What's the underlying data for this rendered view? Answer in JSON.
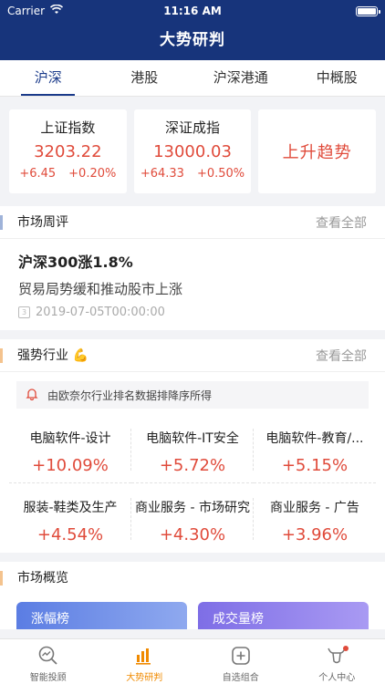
{
  "status_bar": {
    "carrier": "Carrier",
    "time": "11:16 AM"
  },
  "nav": {
    "title": "大势研判"
  },
  "tabs": [
    {
      "label": "沪深",
      "active": true
    },
    {
      "label": "港股",
      "active": false
    },
    {
      "label": "沪深港通",
      "active": false
    },
    {
      "label": "中概股",
      "active": false
    }
  ],
  "indices": [
    {
      "name": "上证指数",
      "value": "3203.22",
      "change": "+6.45",
      "pct": "+0.20%"
    },
    {
      "name": "深证成指",
      "value": "13000.03",
      "change": "+64.33",
      "pct": "+0.50%"
    }
  ],
  "trend": {
    "label": "上升趋势"
  },
  "market_review": {
    "title": "市场周评",
    "more": "查看全部",
    "headline": "沪深300涨1.8%",
    "subtitle": "贸易局势缓和推动股市上涨",
    "date": "2019-07-05T00:00:00",
    "calendar_day": "3"
  },
  "strong_industries": {
    "title": "强势行业",
    "emoji": "💪",
    "more": "查看全部",
    "notice": "由欧奈尔行业排名数据排降序所得",
    "items": [
      {
        "name": "电脑软件-设计",
        "pct": "+10.09%"
      },
      {
        "name": "电脑软件-IT安全",
        "pct": "+5.72%"
      },
      {
        "name": "电脑软件-教育/...",
        "pct": "+5.15%"
      },
      {
        "name": "服装-鞋类及生产",
        "pct": "+4.54%"
      },
      {
        "name": "商业服务 - 市场研究",
        "pct": "+4.30%"
      },
      {
        "name": "商业服务 - 广告",
        "pct": "+3.96%"
      }
    ]
  },
  "market_overview": {
    "title": "市场概览",
    "cards": [
      {
        "label": "涨幅榜"
      },
      {
        "label": "成交量榜"
      }
    ]
  },
  "tabbar": [
    {
      "label": "智能投顾",
      "icon": "magnifier-chart-icon",
      "active": false
    },
    {
      "label": "大势研判",
      "icon": "bar-chart-icon",
      "active": true
    },
    {
      "label": "自选组合",
      "icon": "plus-square-icon",
      "active": false
    },
    {
      "label": "个人中心",
      "icon": "bull-icon",
      "active": false
    }
  ],
  "colors": {
    "header": "#17347b",
    "up": "#e04b3b",
    "active_tab": "#f08a00"
  }
}
